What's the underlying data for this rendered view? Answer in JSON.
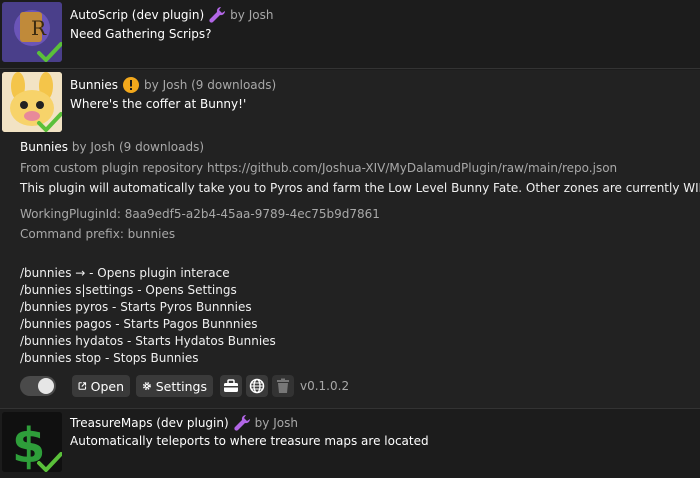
{
  "plugins": [
    {
      "name": "AutoScrip (dev plugin)",
      "author": "by Josh",
      "description": "Need Gathering Scrips?"
    },
    {
      "name": "Bunnies",
      "author_downloads": "by Josh (9 downloads)",
      "description": "Where's the coffer at Bunny!'",
      "details": {
        "name": "Bunnies",
        "author_downloads": "by Josh (9 downloads)",
        "source": "From custom plugin repository https://github.com/Joshua-XIV/MyDalamudPlugin/raw/main/repo.json",
        "long_description": "This plugin will automatically take you to Pyros and farm the Low Level Bunny Fate. Other zones are currently WIP.",
        "working_id": "WorkingPluginId: 8aa9edf5-a2b4-45aa-9789-4ec75b9d7861",
        "command_prefix": "Command prefix: bunnies",
        "commands": [
          "/bunnies → - Opens plugin interace",
          "/bunnies s|settings - Opens Settings",
          "/bunnies pyros - Starts Pyros Bunnnies",
          "/bunnies pagos - Starts Pagos Bunnnies",
          "/bunnies hydatos - Starts Hydatos Bunnies",
          "/bunnies stop - Stops Bunnies"
        ],
        "open_label": "Open",
        "settings_label": "Settings",
        "version": "v0.1.0.2"
      }
    },
    {
      "name": "TreasureMaps (dev plugin)",
      "author": "by Josh",
      "description": "Automatically teleports to where treasure maps are located"
    }
  ],
  "colors": {
    "dev_wrench": "#b266e6",
    "warning_badge": "#f2a81c",
    "check": "#5ac03a",
    "dollar": "#2e9e3a"
  }
}
